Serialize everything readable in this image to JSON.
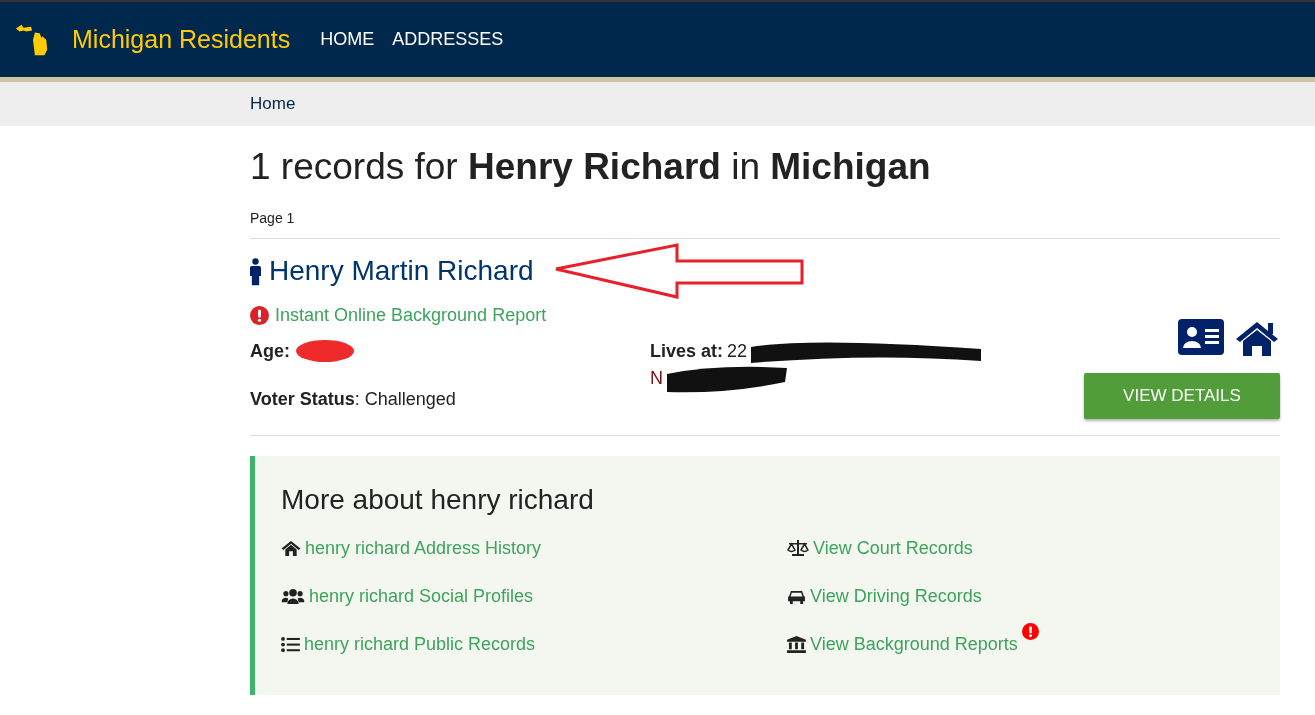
{
  "navbar": {
    "brand": "Michigan Residents",
    "links": [
      "HOME",
      "ADDRESSES"
    ]
  },
  "breadcrumb": [
    "Home"
  ],
  "heading": "1 records for **Henry Richard** in  **Michigan**",
  "page_label": "Page 1",
  "record": {
    "name": "Henry Martin Richard",
    "report_link": "Instant Online Background Report",
    "age_label": "Age:",
    "lives_label": "Lives at:",
    "address_lines": [
      "22",
      "N"
    ],
    "voter_label": "Voter Status",
    "voter_value": ": Challenged",
    "button": "VIEW DETAILS"
  },
  "more": {
    "title": "More about henry richard",
    "links": [
      {
        "text": "henry richard Address History",
        "kind": "home",
        "alert": false
      },
      {
        "text": "View Court Records",
        "kind": "scale",
        "alert": false
      },
      {
        "text": "henry richard Social Profiles",
        "kind": "users",
        "alert": false
      },
      {
        "text": "View Driving Records",
        "kind": "car",
        "alert": false
      },
      {
        "text": "henry richard Public Records",
        "kind": "list",
        "alert": false
      },
      {
        "text": "View Background Reports",
        "kind": "bank",
        "alert": true
      }
    ]
  }
}
